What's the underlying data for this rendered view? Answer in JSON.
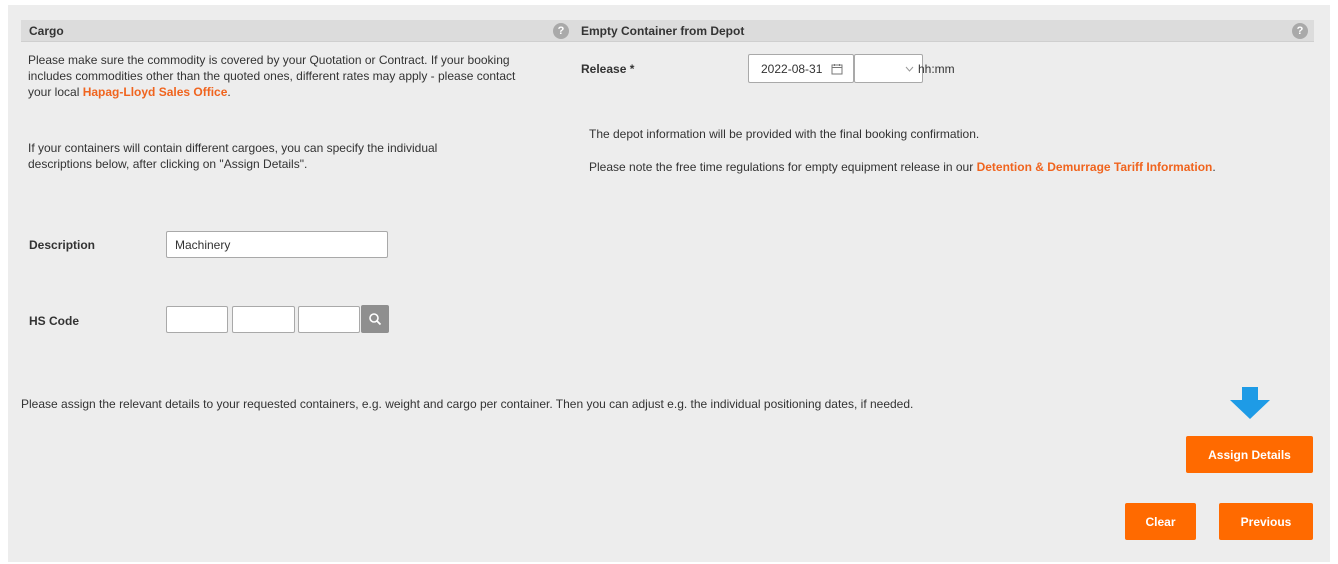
{
  "cargo": {
    "title": "Cargo",
    "help": "?",
    "intro_text": "Please make sure the commodity is covered by your Quotation or Contract. If your booking includes commodities other than the quoted ones, different rates may apply - please contact your local ",
    "sales_link": "Hapag-Lloyd Sales Office",
    "intro_end": ".",
    "assign_text": "If your containers will contain different cargoes, you can specify the individual descriptions below, after clicking on \"Assign Details\".",
    "description_label": "Description",
    "description_value": "Machinery",
    "hs_code_label": "HS Code",
    "hs_code_values": [
      "",
      "",
      ""
    ]
  },
  "depot": {
    "title": "Empty Container from Depot",
    "help": "?",
    "release_label": "Release *",
    "release_date": "2022-08-31",
    "time_placeholder": "hh:mm",
    "info_text": "The depot information will be provided with the final booking confirmation.",
    "free_time_text": "Please note the free time regulations for empty equipment release in our ",
    "tariff_link": "Detention & Demurrage Tariff Information",
    "free_time_end": "."
  },
  "footer": {
    "assign_hint": "Please assign the relevant details to your requested containers, e.g. weight and cargo per container. Then you can adjust e.g. the individual positioning dates, if needed.",
    "assign_details_label": "Assign Details",
    "clear_label": "Clear",
    "previous_label": "Previous"
  },
  "colors": {
    "accent": "#ff6a00",
    "link": "#f0641e",
    "arrow": "#1e9be6"
  }
}
